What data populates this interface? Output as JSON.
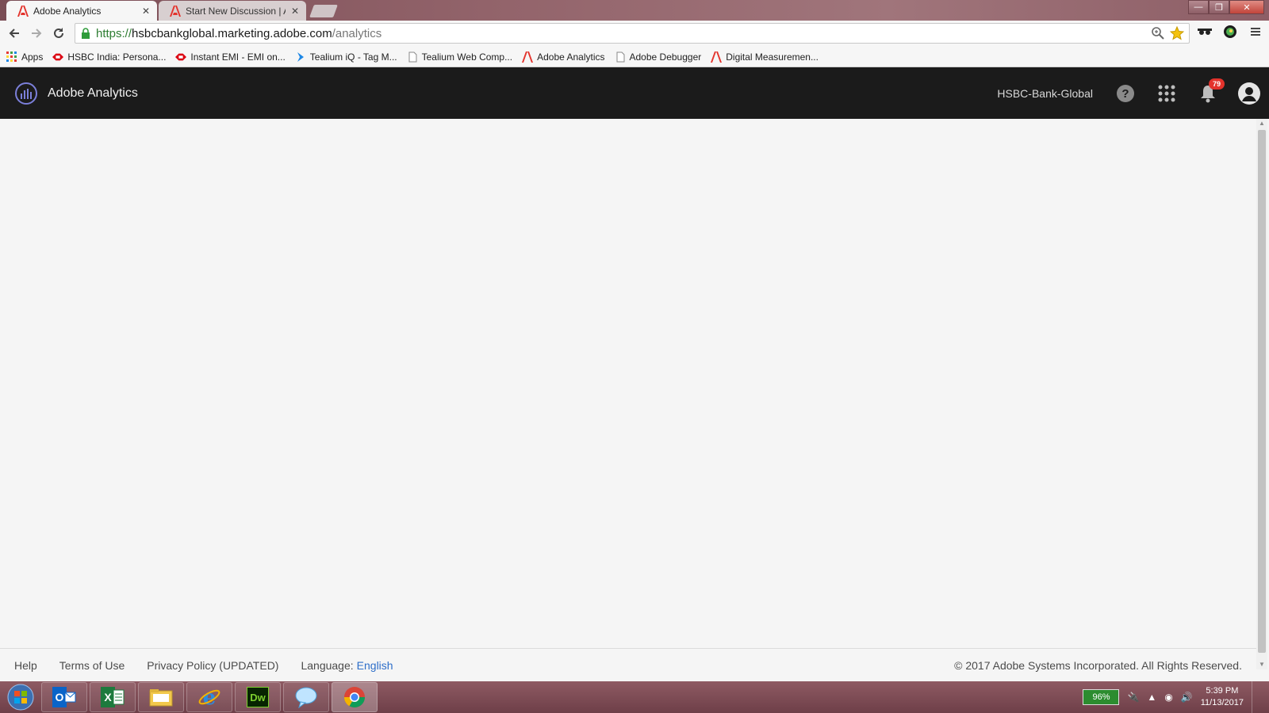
{
  "browser": {
    "tabs": [
      {
        "title": "Adobe Analytics",
        "active": true
      },
      {
        "title": "Start New Discussion | Adobe",
        "active": false
      }
    ],
    "url": {
      "scheme": "https://",
      "host": "hsbcbankglobal.marketing.adobe.com",
      "path": "/analytics"
    },
    "bookmarks": [
      {
        "label": "Apps",
        "icon": "apps-grid-icon"
      },
      {
        "label": "HSBC India: Persona...",
        "icon": "hsbc-logo-icon"
      },
      {
        "label": "Instant EMI - EMI on...",
        "icon": "hsbc-logo-icon"
      },
      {
        "label": "Tealium iQ - Tag M...",
        "icon": "tealium-icon"
      },
      {
        "label": "Tealium Web Comp...",
        "icon": "page-icon"
      },
      {
        "label": "Adobe Analytics",
        "icon": "adobe-logo-icon"
      },
      {
        "label": "Adobe Debugger",
        "icon": "page-icon"
      },
      {
        "label": "Digital Measuremen...",
        "icon": "adobe-logo-icon"
      }
    ]
  },
  "app": {
    "name": "Adobe Analytics",
    "org": "HSBC-Bank-Global",
    "notifications_count": "79"
  },
  "footer": {
    "links": [
      "Help",
      "Terms of Use",
      "Privacy Policy (UPDATED)"
    ],
    "language_label": "Language:",
    "language_value": "English",
    "copyright": "© 2017 Adobe Systems Incorporated. All Rights Reserved."
  },
  "taskbar": {
    "apps": [
      "outlook-icon",
      "excel-icon",
      "file-explorer-icon",
      "internet-explorer-icon",
      "dreamweaver-icon",
      "messenger-icon",
      "chrome-icon"
    ],
    "battery": "96%",
    "time": "5:39 PM",
    "date": "11/13/2017"
  },
  "colors": {
    "header_bg": "#1b1b1b",
    "page_bg": "#f5f5f5",
    "link_blue": "#2d6ec9",
    "badge_red": "#e3332c"
  }
}
